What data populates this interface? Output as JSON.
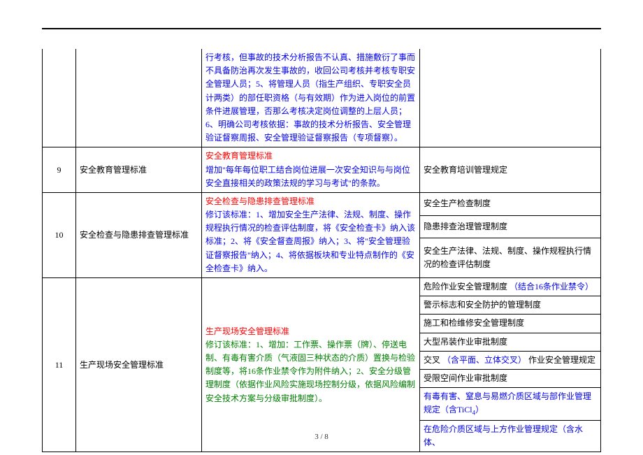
{
  "page": {
    "current": 3,
    "total": 8,
    "sep": " / "
  },
  "row_cont": {
    "desc_cont": "行考核，但事故的技术分析报告不认真、措施敷衍了事而不具备防治再次发生事故的，收回公司考核并考核专职安全管理人员；5、将管理人员（指生产组织、专职安全员计两类）的部任职资格（与有效期）作为进入岗位的前置条件进展管理，否那么考核决定岗位调整的上层人员；6、明确公司考核依据：事故的技术分析报告、安全管理验证督察周报、安全管理验证督察报告（专项督察）。"
  },
  "r9": {
    "num": "9",
    "name": "安全教育管理标准",
    "title": "安全教育管理标准",
    "desc": "增加\"每年每位职工结合岗位进展一次安全知识与与岗位安全直接相关的政策法规的学习与考试\"的条款。",
    "right": "安全教育培训管理规定"
  },
  "r10": {
    "num": "10",
    "name": "安全检查与隐患排查管理标准",
    "title": "安全检查与隐患排查管理标准",
    "desc": "修订该标准：1、增加安全生产法律、法规、制度、操作规程执行情况的检查评估制度，将《安全检查卡》纳入该标准；2、将《安全督查周报》纳入；3、将\"安全管理验证督察报告\"纳入；4、将依据板块和专业特点制作的《安全检查卡》纳入。",
    "right1": "安全生产检查制度",
    "right2": "隐患排查治理管理制度",
    "right3": "安全生产法律、法规、制度、操作规程执行情况的检查评估制度"
  },
  "r11": {
    "num": "11",
    "name": "生产现场安全管理标准",
    "title": "生产现场安全管理标准",
    "desc": "修订该标准：1、增加：工作票、操作票（牌）、停送电制、有毒有害介质（气液固三种状态的介质）置换与检验制度等，将16条作业禁令作为附件纳入；2、安全分级管理制度（依据作业风险实施现场控制分级，依据风险编制安全技术方案与分级审批制度）。",
    "right1_a": "危险作业安全管理制度",
    "right1_b": "（结合16条作业禁令）",
    "right2": "警示标志和安全防护的管理制度",
    "right3": "施工和检维修安全管理制度",
    "right4": "大型吊装作业审批制度",
    "right5_a": "交叉",
    "right5_b": "（含平面、立体交叉）",
    "right5_c": "作业安全管理规定",
    "right6": "受限空间作业审批制度",
    "right7_a": "有毒有害、窒息与易燃介质区域与部作业管理规定（含TiCl",
    "right7_b": "4",
    "right7_c": "）",
    "right8": "在危险介质区域与上方作业管理规定（含水体、"
  }
}
